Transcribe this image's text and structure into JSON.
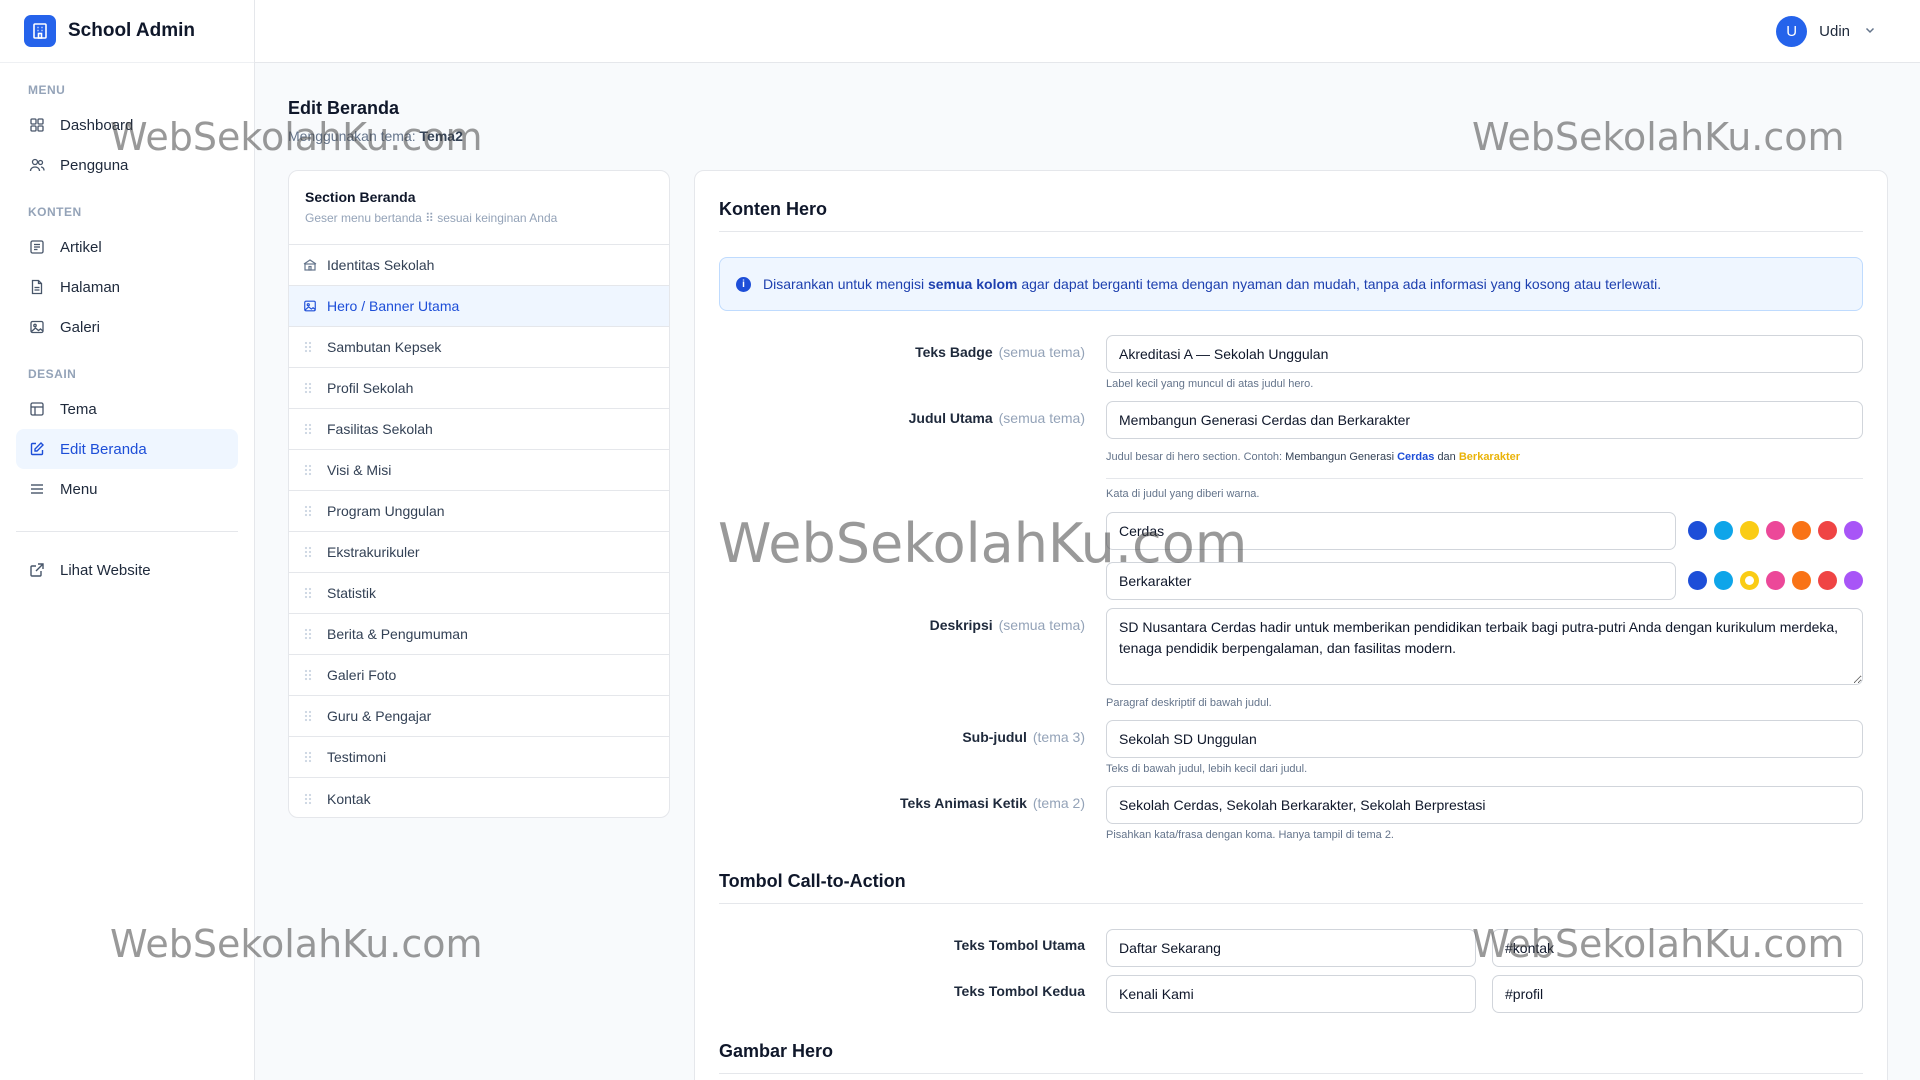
{
  "app": {
    "title": "School Admin"
  },
  "sidebar": {
    "sections": [
      {
        "label": "MENU",
        "items": [
          {
            "label": "Dashboard",
            "icon": "grid-icon",
            "active": false
          },
          {
            "label": "Pengguna",
            "icon": "users-icon",
            "active": false
          }
        ]
      },
      {
        "label": "KONTEN",
        "items": [
          {
            "label": "Artikel",
            "icon": "article-icon",
            "active": false
          },
          {
            "label": "Halaman",
            "icon": "page-icon",
            "active": false
          },
          {
            "label": "Galeri",
            "icon": "image-icon",
            "active": false
          }
        ]
      },
      {
        "label": "DESAIN",
        "items": [
          {
            "label": "Tema",
            "icon": "theme-icon",
            "active": false
          },
          {
            "label": "Edit Beranda",
            "icon": "edit-icon",
            "active": true
          },
          {
            "label": "Menu",
            "icon": "menu-icon",
            "active": false
          }
        ]
      }
    ],
    "external": {
      "label": "Lihat Website",
      "icon": "external-link-icon"
    }
  },
  "user": {
    "initial": "U",
    "name": "Udin"
  },
  "page": {
    "title": "Edit Beranda",
    "subtitle_prefix": "Menggunakan tema:",
    "theme_name": "Tema2"
  },
  "sections_panel": {
    "title": "Section Beranda",
    "subtitle": "Geser menu bertanda ⠿ sesuai keinginan Anda",
    "items": [
      {
        "label": "Identitas Sekolah",
        "icon": "school-icon",
        "active": false
      },
      {
        "label": "Hero / Banner Utama",
        "icon": "image-icon",
        "active": true
      },
      {
        "label": "Sambutan Kepsek",
        "icon": "drag-handle-icon",
        "active": false
      },
      {
        "label": "Profil Sekolah",
        "icon": "drag-handle-icon",
        "active": false
      },
      {
        "label": "Fasilitas Sekolah",
        "icon": "drag-handle-icon",
        "active": false
      },
      {
        "label": "Visi & Misi",
        "icon": "drag-handle-icon",
        "active": false
      },
      {
        "label": "Program Unggulan",
        "icon": "drag-handle-icon",
        "active": false
      },
      {
        "label": "Ekstrakurikuler",
        "icon": "drag-handle-icon",
        "active": false
      },
      {
        "label": "Statistik",
        "icon": "drag-handle-icon",
        "active": false
      },
      {
        "label": "Berita & Pengumuman",
        "icon": "drag-handle-icon",
        "active": false
      },
      {
        "label": "Galeri Foto",
        "icon": "drag-handle-icon",
        "active": false
      },
      {
        "label": "Guru & Pengajar",
        "icon": "drag-handle-icon",
        "active": false
      },
      {
        "label": "Testimoni",
        "icon": "drag-handle-icon",
        "active": false
      },
      {
        "label": "Kontak",
        "icon": "drag-handle-icon",
        "active": false
      }
    ]
  },
  "hero": {
    "heading": "Konten Hero",
    "alert": {
      "before": "Disarankan untuk mengisi ",
      "bold": "semua kolom",
      "after": " agar dapat berganti tema dengan nyaman dan mudah, tanpa ada informasi yang kosong atau terlewati."
    },
    "badge": {
      "label": "Teks Badge",
      "scope": "(semua tema)",
      "value": "Akreditasi A — Sekolah Unggulan",
      "help": "Label kecil yang muncul di atas judul hero."
    },
    "title": {
      "label": "Judul Utama",
      "scope": "(semua tema)",
      "value": "Membangun Generasi Cerdas dan Berkarakter",
      "help_prefix": "Judul besar di hero section. Contoh:",
      "help_example_start": "Membangun Generasi",
      "help_word1": "Cerdas",
      "help_and": "dan",
      "help_word2": "Berkarakter",
      "highlight_help": "Kata di judul yang diberi warna.",
      "highlight1": "Cerdas",
      "highlight2": "Berkarakter"
    },
    "description": {
      "label": "Deskripsi",
      "scope": "(semua tema)",
      "value": "SD Nusantara Cerdas hadir untuk memberikan pendidikan terbaik bagi putra-putri Anda dengan kurikulum merdeka, tenaga pendidik berpengalaman, dan fasilitas modern.",
      "help": "Paragraf deskriptif di bawah judul."
    },
    "subtitle": {
      "label": "Sub-judul",
      "scope": "(tema 3)",
      "value": "Sekolah SD Unggulan",
      "help": "Teks di bawah judul, lebih kecil dari judul."
    },
    "typing": {
      "label": "Teks Animasi Ketik",
      "scope": "(tema 2)",
      "value": "Sekolah Cerdas, Sekolah Berkarakter, Sekolah Berprestasi",
      "help": "Pisahkan kata/frasa dengan koma. Hanya tampil di tema 2."
    }
  },
  "palette": {
    "colors": [
      "#1d4ed8",
      "#0ea5e9",
      "#facc15",
      "#ec4899",
      "#f97316",
      "#ef4444",
      "#a855f7"
    ],
    "selected_row1": -1,
    "selected_row2": 2
  },
  "cta": {
    "heading": "Tombol Call-to-Action",
    "primary": {
      "label": "Teks Tombol Utama",
      "text": "Daftar Sekarang",
      "link": "#kontak"
    },
    "secondary": {
      "label": "Teks Tombol Kedua",
      "text": "Kenali Kami",
      "link": "#profil"
    }
  },
  "image_section": {
    "heading": "Gambar Hero"
  },
  "watermark": "WebSekolahKu.com"
}
